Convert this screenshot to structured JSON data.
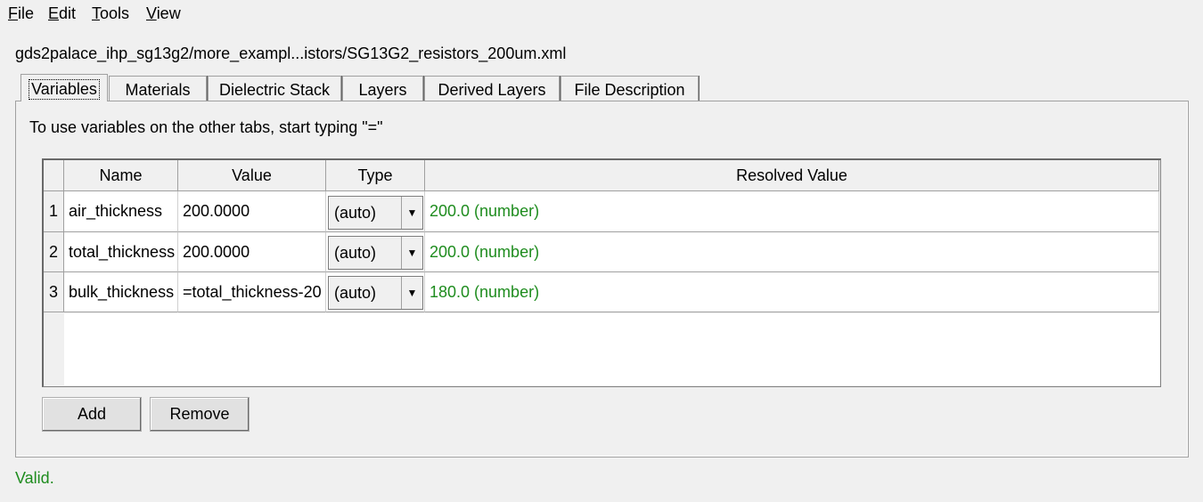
{
  "menu": {
    "file": {
      "hot": "F",
      "rest": "ile"
    },
    "edit": {
      "hot": "E",
      "rest": "dit"
    },
    "tools": {
      "hot": "T",
      "rest": "ools"
    },
    "view": {
      "hot": "V",
      "rest": "iew"
    }
  },
  "file_path": "gds2palace_ihp_sg13g2/more_exampl...istors/SG13G2_resistors_200um.xml",
  "tabs": [
    "Variables",
    "Materials",
    "Dielectric Stack",
    "Layers",
    "Derived Layers",
    "File Description"
  ],
  "active_tab": "Variables",
  "hint": "To use variables on the other tabs, start typing \"=\"",
  "table": {
    "headers": [
      "Name",
      "Value",
      "Type",
      "Resolved Value"
    ],
    "rows": [
      {
        "num": "1",
        "name": "air_thickness",
        "value": "200.0000",
        "type": "(auto)",
        "resolved": "200.0 (number)"
      },
      {
        "num": "2",
        "name": "total_thickness",
        "value": "200.0000",
        "type": "(auto)",
        "resolved": "200.0 (number)"
      },
      {
        "num": "3",
        "name": "bulk_thickness",
        "value": "=total_thickness-20",
        "type": "(auto)",
        "resolved": "180.0 (number)"
      }
    ]
  },
  "buttons": {
    "add": "Add",
    "remove": "Remove"
  },
  "status": "Valid.",
  "colors": {
    "valid_green": "#1e8c1e",
    "background": "#f0f0f0"
  },
  "icons": {
    "dropdown_arrow": "▼"
  }
}
